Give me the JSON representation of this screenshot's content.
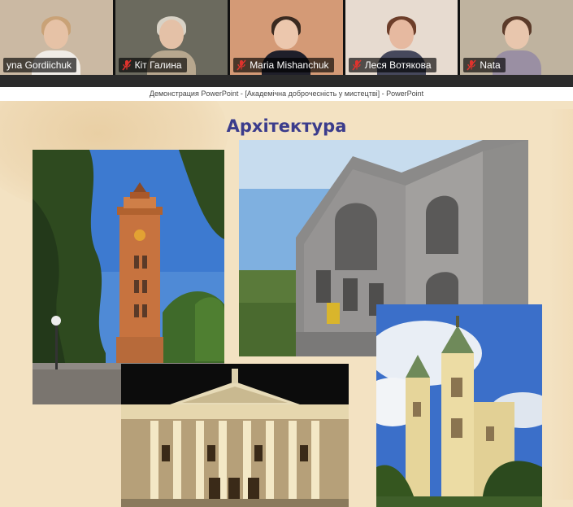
{
  "participants": [
    {
      "name": "yna Gordiichuk",
      "muted": false,
      "bg": "#cbb9a3",
      "skin": "#e6c2a6",
      "hair": "#c9a277",
      "shirt": "#f0ece7"
    },
    {
      "name": "Кіт Галина",
      "muted": true,
      "bg": "#6b6a5e",
      "skin": "#e4c1a7",
      "hair": "#d8d2c6",
      "shirt": "#b7a78e"
    },
    {
      "name": "Maria Mishanchuk",
      "muted": true,
      "bg": "#d49a76",
      "skin": "#ecc7ad",
      "hair": "#3a2a20",
      "shirt": "#1f1f2a"
    },
    {
      "name": "Леся Вотякова",
      "muted": true,
      "bg": "#e7dbd0",
      "skin": "#e6b9a0",
      "hair": "#6d3e2a",
      "shirt": "#46485c"
    },
    {
      "name": "Nata",
      "muted": true,
      "bg": "#bfb39f",
      "skin": "#e8c6ad",
      "hair": "#5b3b2a",
      "shirt": "#9a8fa3"
    }
  ],
  "window_title": "Демонстрация PowerPoint - [Академічна доброчесність у мистецтві] - PowerPoint",
  "slide": {
    "title": "Архітектура"
  },
  "colors": {
    "slide_bg": "#f3e2c2",
    "title": "#3b3c8c",
    "mic_off": "#e0332d"
  }
}
